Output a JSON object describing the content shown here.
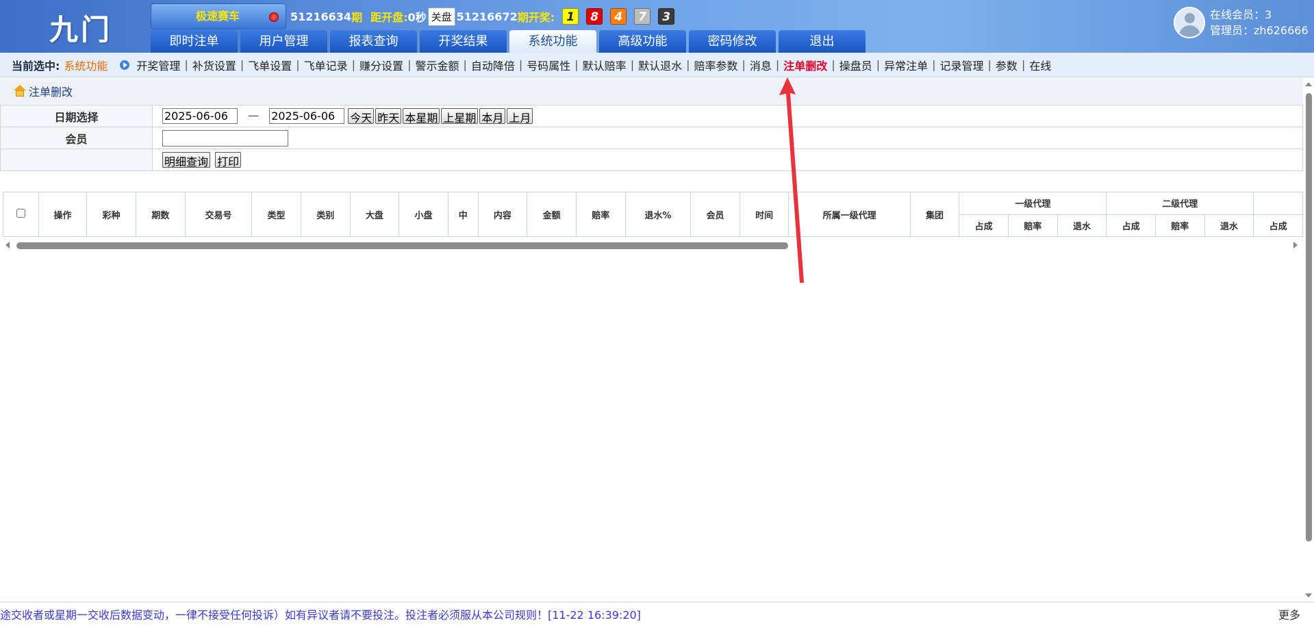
{
  "header": {
    "logo": "九门",
    "game": "极速赛车",
    "current_period": "51216634",
    "period_suffix": "期",
    "countdown_label": "距开盘:",
    "countdown_value": "0秒",
    "close_label": "关盘",
    "last_period": "51216672",
    "draw_label": "期开奖:",
    "balls": [
      "1",
      "8",
      "4",
      "7",
      "3"
    ],
    "online_members": "在线会员：3",
    "admin": "管理员：zh626666"
  },
  "nav": {
    "tabs": [
      {
        "label": "即时注单"
      },
      {
        "label": "用户管理"
      },
      {
        "label": "报表查询"
      },
      {
        "label": "开奖结果"
      },
      {
        "label": "系统功能",
        "active": true
      },
      {
        "label": "高级功能"
      },
      {
        "label": "密码修改"
      },
      {
        "label": "退出"
      }
    ]
  },
  "submenu": {
    "current_label": "当前选中:",
    "current_value": "系统功能",
    "items": [
      "开奖管理",
      "补货设置",
      "飞单设置",
      "飞单记录",
      "赚分设置",
      "警示金额",
      "自动降倍",
      "号码属性",
      "默认赔率",
      "默认退水",
      "赔率参数",
      "消息",
      "注单删改",
      "操盘员",
      "异常注单",
      "记录管理",
      "参数",
      "在线"
    ],
    "highlighted": "注单删改"
  },
  "page": {
    "title": "注单删改"
  },
  "filter": {
    "date_label": "日期选择",
    "date_from": "2025-06-06",
    "date_sep": "—",
    "date_to": "2025-06-06",
    "quick_buttons": [
      "今天",
      "昨天",
      "本星期",
      "上星期",
      "本月",
      "上月"
    ],
    "member_label": "会员",
    "member_value": "",
    "query_button": "明细查询",
    "print_button": "打印"
  },
  "table": {
    "columns": [
      "操作",
      "彩种",
      "期数",
      "交易号",
      "类型",
      "类别",
      "大盘",
      "小盘",
      "中",
      "内容",
      "金额",
      "赔率",
      "退水%",
      "会员",
      "时间",
      "所属一级代理",
      "集团"
    ],
    "group1": "一级代理",
    "group2": "二级代理",
    "subcols": [
      "占成",
      "赔率",
      "退水"
    ],
    "last_subcol": "占成"
  },
  "footer": {
    "ticker": "途交收者或星期一交收后数据变动，一律不接受任何投诉）如有异议者请不要投注。投注者必须服从本公司规则！[11-22 16:39:20]",
    "more": "更多"
  },
  "colors": {
    "header_blue": "#3d6fc8",
    "highlight_red": "#e0002c",
    "current_orange": "#e86a0c",
    "annotation_arrow": "#e8323c"
  }
}
